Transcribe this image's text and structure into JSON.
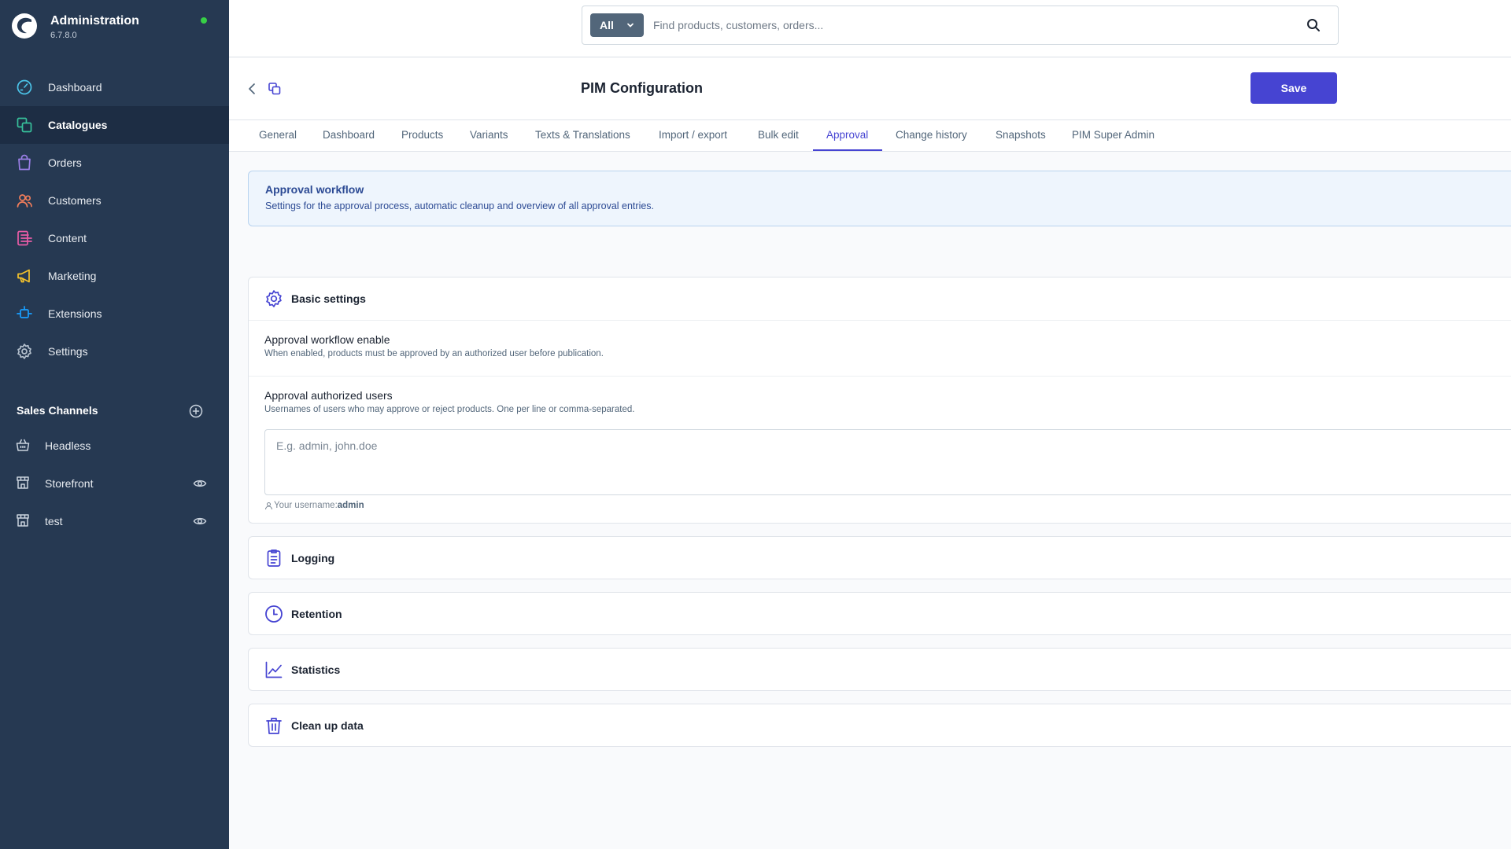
{
  "app": {
    "title": "Administration",
    "version": "6.7.8.0"
  },
  "sidebar": {
    "items": [
      {
        "label": "Dashboard",
        "icon": "dashboard-icon",
        "color": "#4bc3e8"
      },
      {
        "label": "Catalogues",
        "icon": "catalogues-icon",
        "color": "#37c09b",
        "active": true
      },
      {
        "label": "Orders",
        "icon": "orders-icon",
        "color": "#9b7fe6"
      },
      {
        "label": "Customers",
        "icon": "customers-icon",
        "color": "#f47e5b"
      },
      {
        "label": "Content",
        "icon": "content-icon",
        "color": "#e85ca6"
      },
      {
        "label": "Marketing",
        "icon": "marketing-icon",
        "color": "#f5c32b"
      },
      {
        "label": "Extensions",
        "icon": "extensions-icon",
        "color": "#189eff"
      },
      {
        "label": "Settings",
        "icon": "settings-icon",
        "color": "#b3bfcc"
      }
    ],
    "sales_channels": {
      "header": "Sales Channels",
      "items": [
        {
          "label": "Headless",
          "icon": "basket-icon",
          "has_eye": false
        },
        {
          "label": "Storefront",
          "icon": "storefront-icon",
          "has_eye": true
        },
        {
          "label": "test",
          "icon": "storefront-icon",
          "has_eye": true
        }
      ]
    }
  },
  "search": {
    "scope": "All",
    "placeholder": "Find products, customers, orders..."
  },
  "page": {
    "title": "PIM Configuration",
    "save_label": "Save"
  },
  "tabs": [
    {
      "label": "General"
    },
    {
      "label": "Dashboard"
    },
    {
      "label": "Products"
    },
    {
      "label": "Variants"
    },
    {
      "label": "Texts & Translations"
    },
    {
      "label": "Import / export"
    },
    {
      "label": "Bulk edit"
    },
    {
      "label": "Approval",
      "active": true
    },
    {
      "label": "Change history"
    },
    {
      "label": "Snapshots"
    },
    {
      "label": "PIM Super Admin"
    }
  ],
  "info": {
    "title": "Approval workflow",
    "text": "Settings for the approval process, automatic cleanup and overview of all approval entries."
  },
  "basic_settings": {
    "title": "Basic settings",
    "workflow_enable_label": "Approval workflow enable",
    "workflow_enable_help": "When enabled, products must be approved by an authorized user before publication.",
    "authorized_users_label": "Approval authorized users",
    "authorized_users_help": "Usernames of users who may approve or reject products. One per line or comma-separated.",
    "authorized_users_placeholder": "E.g. admin, john.doe",
    "authorized_users_value": "",
    "username_hint_prefix": "Your username:",
    "username": "admin"
  },
  "sections": {
    "logging": "Logging",
    "retention": "Retention",
    "statistics": "Statistics",
    "cleanup": "Clean up data"
  },
  "colors": {
    "sidebar_bg": "#263952",
    "accent": "#4644d2",
    "status_online": "#37d046"
  }
}
